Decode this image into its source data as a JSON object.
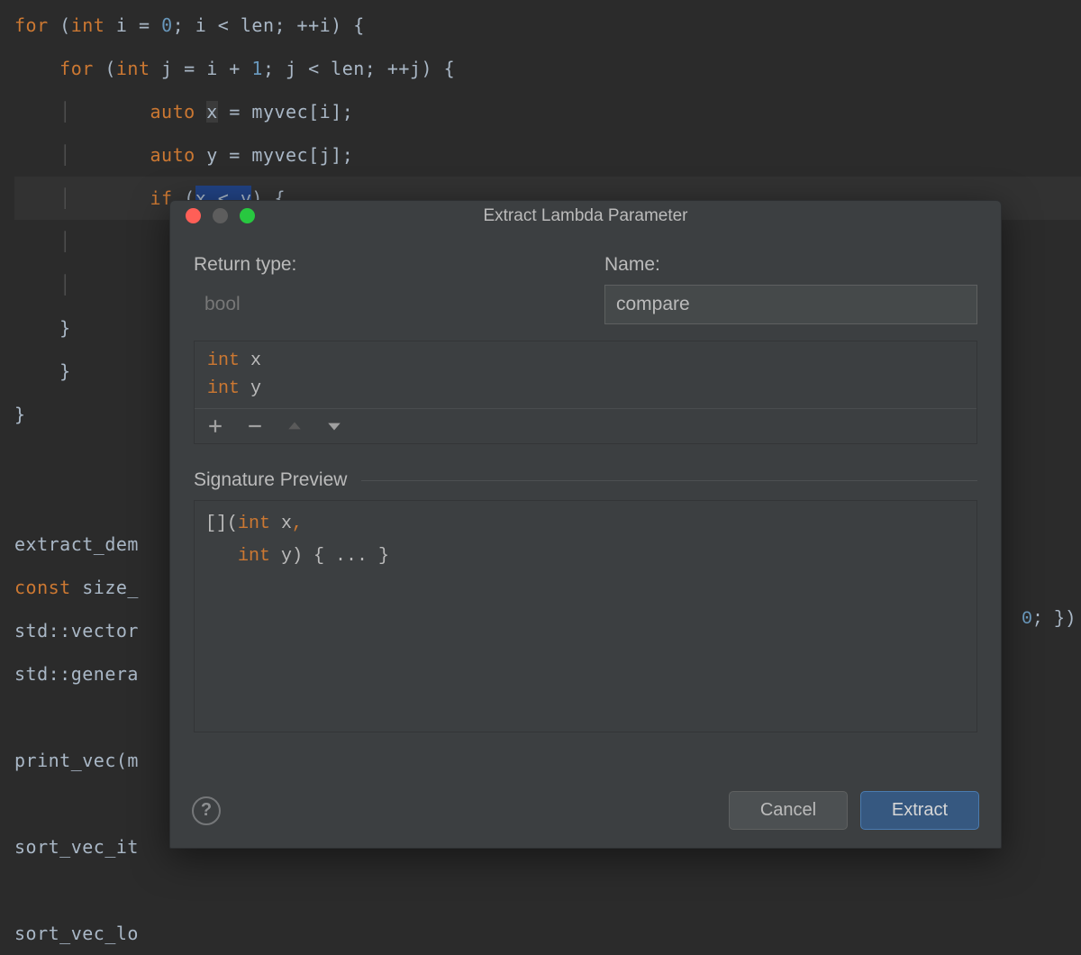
{
  "editor": {
    "lines": [
      {
        "tokens": [
          {
            "t": "kw",
            "v": "for"
          },
          {
            "t": "punc",
            "v": " ("
          },
          {
            "t": "kw",
            "v": "int"
          },
          {
            "t": "punc",
            "v": " i "
          },
          {
            "t": "punc",
            "v": "= "
          },
          {
            "t": "num",
            "v": "0"
          },
          {
            "t": "punc",
            "v": "; i < len; ++i) {"
          }
        ]
      },
      {
        "indent": 1,
        "tokens": [
          {
            "t": "kw",
            "v": "for"
          },
          {
            "t": "punc",
            "v": " ("
          },
          {
            "t": "kw",
            "v": "int"
          },
          {
            "t": "punc",
            "v": " j = i + "
          },
          {
            "t": "num",
            "v": "1"
          },
          {
            "t": "punc",
            "v": "; j < len; ++j) {"
          }
        ]
      },
      {
        "indent": 2,
        "tokens": [
          {
            "t": "kw",
            "v": "auto"
          },
          {
            "t": "punc",
            "v": " "
          },
          {
            "t": "hl",
            "v": "x"
          },
          {
            "t": "punc",
            "v": " = myvec[i];"
          }
        ]
      },
      {
        "indent": 2,
        "tokens": [
          {
            "t": "kw",
            "v": "auto"
          },
          {
            "t": "punc",
            "v": " y = myvec[j];"
          }
        ]
      },
      {
        "indent": 2,
        "caret": true,
        "tokens": [
          {
            "t": "kw",
            "v": "if"
          },
          {
            "t": "punc",
            "v": " ("
          },
          {
            "t": "sel",
            "v": "x < y"
          },
          {
            "t": "punc",
            "v": ") {"
          }
        ]
      },
      {
        "indent": 2,
        "tokens": []
      },
      {
        "indent": 2,
        "tokens": []
      },
      {
        "indent": 1,
        "tokens": [
          {
            "t": "punc",
            "v": "}"
          }
        ]
      },
      {
        "indent": 1,
        "tokens": [
          {
            "t": "punc",
            "v": "}"
          }
        ],
        "outdent": 1
      },
      {
        "indent": 0,
        "tokens": [
          {
            "t": "punc",
            "v": "}"
          }
        ]
      }
    ],
    "bg_lines": [
      "",
      "extract_dem",
      "const size_",
      "std::vector",
      "std::genera",
      "",
      "print_vec(m",
      "",
      "sort_vec_it",
      "",
      "sort_vec_lo"
    ],
    "bg_tail": "0; })"
  },
  "dialog": {
    "title": "Extract Lambda Parameter",
    "labels": {
      "return_type": "Return type:",
      "name": "Name:",
      "signature": "Signature Preview"
    },
    "return_type_value": "bool",
    "name_value": "compare",
    "params": [
      {
        "type": "int",
        "name": "x"
      },
      {
        "type": "int",
        "name": "y"
      }
    ],
    "signature_lines": [
      [
        {
          "t": "plain",
          "v": "[]("
        },
        {
          "t": "ptype",
          "v": "int"
        },
        {
          "t": "plain",
          "v": " x"
        },
        {
          "t": "comma",
          "v": ","
        }
      ],
      [
        {
          "t": "plain",
          "v": "   "
        },
        {
          "t": "ptype",
          "v": "int"
        },
        {
          "t": "plain",
          "v": " y) { ... }"
        }
      ]
    ],
    "buttons": {
      "cancel": "Cancel",
      "extract": "Extract"
    },
    "help": "?"
  }
}
